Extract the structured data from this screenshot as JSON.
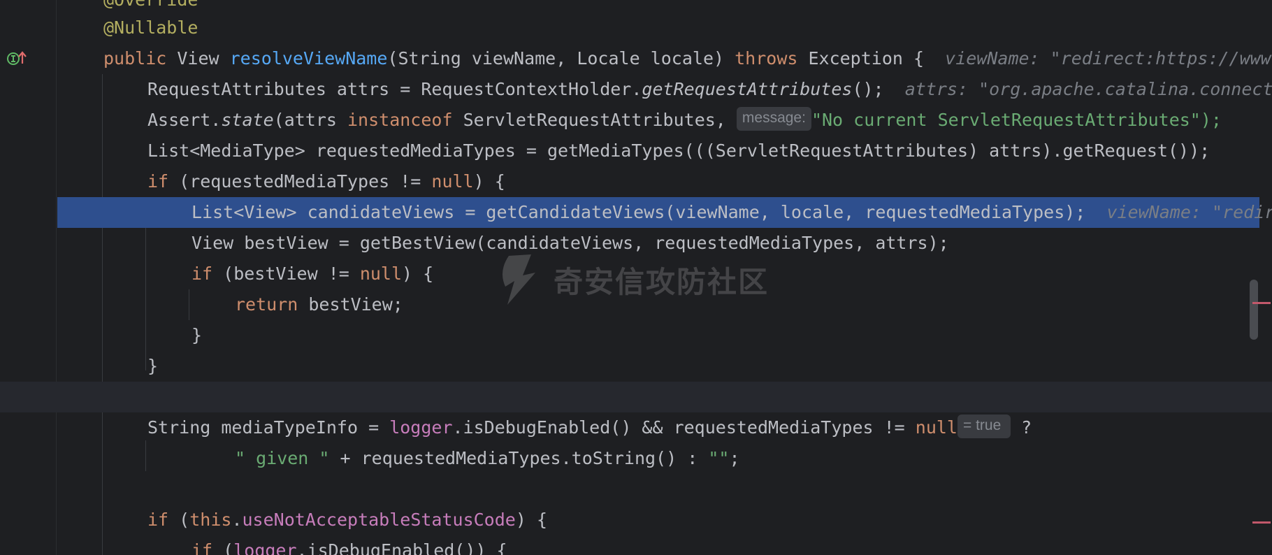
{
  "editor": {
    "lines": [
      {
        "id": "l0",
        "tokens": [
          {
            "t": "@Override",
            "c": "ann"
          }
        ]
      },
      {
        "id": "l1",
        "tokens": [
          {
            "t": "@Nullable",
            "c": "ann"
          }
        ]
      },
      {
        "id": "l2",
        "tokens": [
          {
            "t": "public ",
            "c": "kw"
          },
          {
            "t": "View ",
            "c": ""
          },
          {
            "t": "resolveViewName",
            "c": "fn"
          },
          {
            "t": "(String viewName, Locale locale) ",
            "c": ""
          },
          {
            "t": "throws ",
            "c": "kw"
          },
          {
            "t": "Exception {  ",
            "c": ""
          },
          {
            "t": "viewName: \"redirect:https://www.baidu.com\"",
            "c": "hint"
          }
        ]
      },
      {
        "id": "l3",
        "tokens": [
          {
            "t": "RequestAttributes attrs = RequestContextHolder.",
            "c": ""
          },
          {
            "t": "getRequestAttributes",
            "c": "it"
          },
          {
            "t": "();  ",
            "c": ""
          },
          {
            "t": "attrs: \"org.apache.catalina.connector.RequestFacade\"",
            "c": "hint"
          }
        ]
      },
      {
        "id": "l4",
        "tokens": [
          {
            "t": "Assert.",
            "c": ""
          },
          {
            "t": "state",
            "c": "it"
          },
          {
            "t": "(attrs ",
            "c": ""
          },
          {
            "t": "instanceof ",
            "c": "kw"
          },
          {
            "t": "ServletRequestAttributes, ",
            "c": ""
          },
          {
            "t": "message:",
            "c": "pill"
          },
          {
            "t": "\"No current ServletRequestAttributes\");",
            "c": "str"
          }
        ]
      },
      {
        "id": "l5",
        "tokens": [
          {
            "t": "List<MediaType> requestedMediaTypes = getMediaTypes(((ServletRequestAttributes) attrs).getRequest());",
            "c": ""
          }
        ]
      },
      {
        "id": "l6",
        "tokens": [
          {
            "t": "if ",
            "c": "kw"
          },
          {
            "t": "(requestedMediaTypes != ",
            "c": ""
          },
          {
            "t": "null",
            "c": "kw"
          },
          {
            "t": ") {",
            "c": ""
          }
        ]
      },
      {
        "id": "l7",
        "tokens": [
          {
            "t": "List<View> candidateViews = getCandidateViews(viewName, locale, requestedMediaTypes);  ",
            "c": ""
          },
          {
            "t": "viewName: \"redirect:https://www.baidu.com\"",
            "c": "hint"
          }
        ]
      },
      {
        "id": "l8",
        "tokens": [
          {
            "t": "View bestView = getBestView(candidateViews, requestedMediaTypes, attrs);",
            "c": ""
          }
        ]
      },
      {
        "id": "l9",
        "tokens": [
          {
            "t": "if ",
            "c": "kw"
          },
          {
            "t": "(bestView != ",
            "c": ""
          },
          {
            "t": "null",
            "c": "kw"
          },
          {
            "t": ") {",
            "c": ""
          }
        ]
      },
      {
        "id": "l10",
        "tokens": [
          {
            "t": "return ",
            "c": "kw"
          },
          {
            "t": "bestView;",
            "c": ""
          }
        ]
      },
      {
        "id": "l11",
        "tokens": [
          {
            "t": "}",
            "c": ""
          }
        ]
      },
      {
        "id": "l12",
        "tokens": [
          {
            "t": "}",
            "c": ""
          }
        ]
      },
      {
        "id": "l13",
        "tokens": [
          {
            "t": "",
            "c": ""
          }
        ]
      },
      {
        "id": "l14",
        "tokens": [
          {
            "t": "String mediaTypeInfo = ",
            "c": ""
          },
          {
            "t": "logger",
            "c": "field"
          },
          {
            "t": ".isDebugEnabled() && requestedMediaTypes != ",
            "c": ""
          },
          {
            "t": "null",
            "c": "kw"
          },
          {
            "t": "= true ",
            "c": "pill"
          },
          {
            "t": " ?",
            "c": ""
          }
        ]
      },
      {
        "id": "l15",
        "tokens": [
          {
            "t": "\" given \"",
            "c": "str"
          },
          {
            "t": " + requestedMediaTypes.toString() : ",
            "c": ""
          },
          {
            "t": "\"\"",
            "c": "str"
          },
          {
            "t": ";",
            "c": ""
          }
        ]
      },
      {
        "id": "l16",
        "tokens": [
          {
            "t": "",
            "c": ""
          }
        ]
      },
      {
        "id": "l17",
        "tokens": [
          {
            "t": "if ",
            "c": "kw"
          },
          {
            "t": "(",
            "c": ""
          },
          {
            "t": "this",
            "c": "kw"
          },
          {
            "t": ".",
            "c": ""
          },
          {
            "t": "useNotAcceptableStatusCode",
            "c": "field"
          },
          {
            "t": ") {",
            "c": ""
          }
        ]
      },
      {
        "id": "l18",
        "tokens": [
          {
            "t": "if ",
            "c": "kw"
          },
          {
            "t": "(",
            "c": ""
          },
          {
            "t": "logger",
            "c": "field"
          },
          {
            "t": ".isDebugEnabled()) {",
            "c": ""
          }
        ]
      }
    ]
  },
  "gutter": {
    "icon": "implementation-up-arrow-icon"
  },
  "watermark": {
    "text": "奇安信攻防社区",
    "icon": "lightning-logo-icon"
  },
  "colors": {
    "background": "#1e1f22",
    "selection": "#2e4f8e",
    "keyword": "#cf8e6d",
    "annotation": "#b3ae60",
    "function": "#56a8f5",
    "string": "#6aab73",
    "field": "#c77dbb"
  }
}
